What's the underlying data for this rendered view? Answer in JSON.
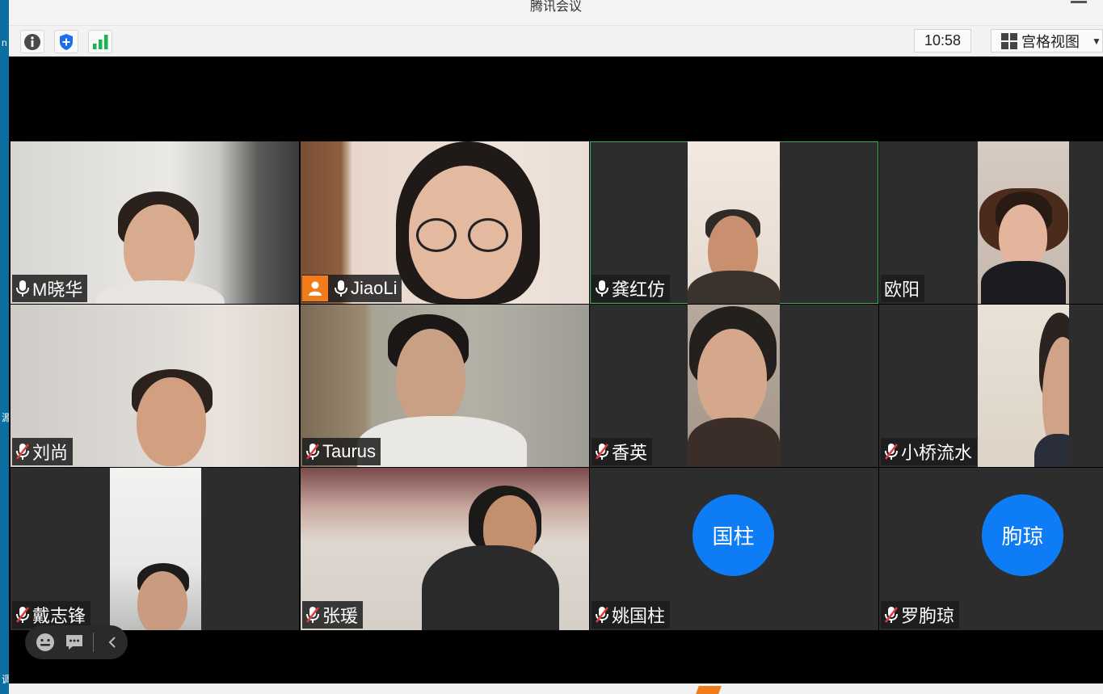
{
  "window": {
    "title": "腾讯会议"
  },
  "left_strip": {
    "fragments": [
      "n",
      "源",
      "调"
    ]
  },
  "toolbar": {
    "info_icon": "info-icon",
    "security_icon": "shield-icon",
    "signal_icon": "signal-bars-icon",
    "clock": "10:58",
    "view_label": "宫格视图",
    "view_icon": "grid-view-icon",
    "view_arrow": "▼"
  },
  "participants": [
    {
      "name": "M晓华",
      "mic": "on",
      "type": "video"
    },
    {
      "name": "JiaoLi",
      "mic": "on",
      "type": "video",
      "host_badge": true
    },
    {
      "name": "龚红仿",
      "mic": "on",
      "type": "video",
      "active_speaker": true
    },
    {
      "name": "欧阳",
      "mic": "none",
      "type": "video"
    },
    {
      "name": "刘尚",
      "mic": "muted",
      "type": "video"
    },
    {
      "name": "Taurus",
      "mic": "muted",
      "type": "video"
    },
    {
      "name": "香英",
      "mic": "muted",
      "type": "video"
    },
    {
      "name": "小桥流水",
      "mic": "muted",
      "type": "video"
    },
    {
      "name": "戴志锋",
      "mic": "muted",
      "type": "video"
    },
    {
      "name": "张瑗",
      "mic": "muted",
      "type": "video"
    },
    {
      "name": "姚国柱",
      "mic": "muted",
      "type": "avatar",
      "avatar_text": "国柱"
    },
    {
      "name": "罗朐琼",
      "mic": "muted",
      "type": "avatar",
      "avatar_text": "朐琼"
    }
  ],
  "floating_bar": {
    "items": [
      "emoji-icon",
      "chat-icon",
      "collapse-chevron-icon"
    ]
  },
  "colors": {
    "accent": "#0e7cf5",
    "active_border": "#36b35a",
    "host_badge": "#f07c1b",
    "muted_red": "#e23b3b"
  }
}
